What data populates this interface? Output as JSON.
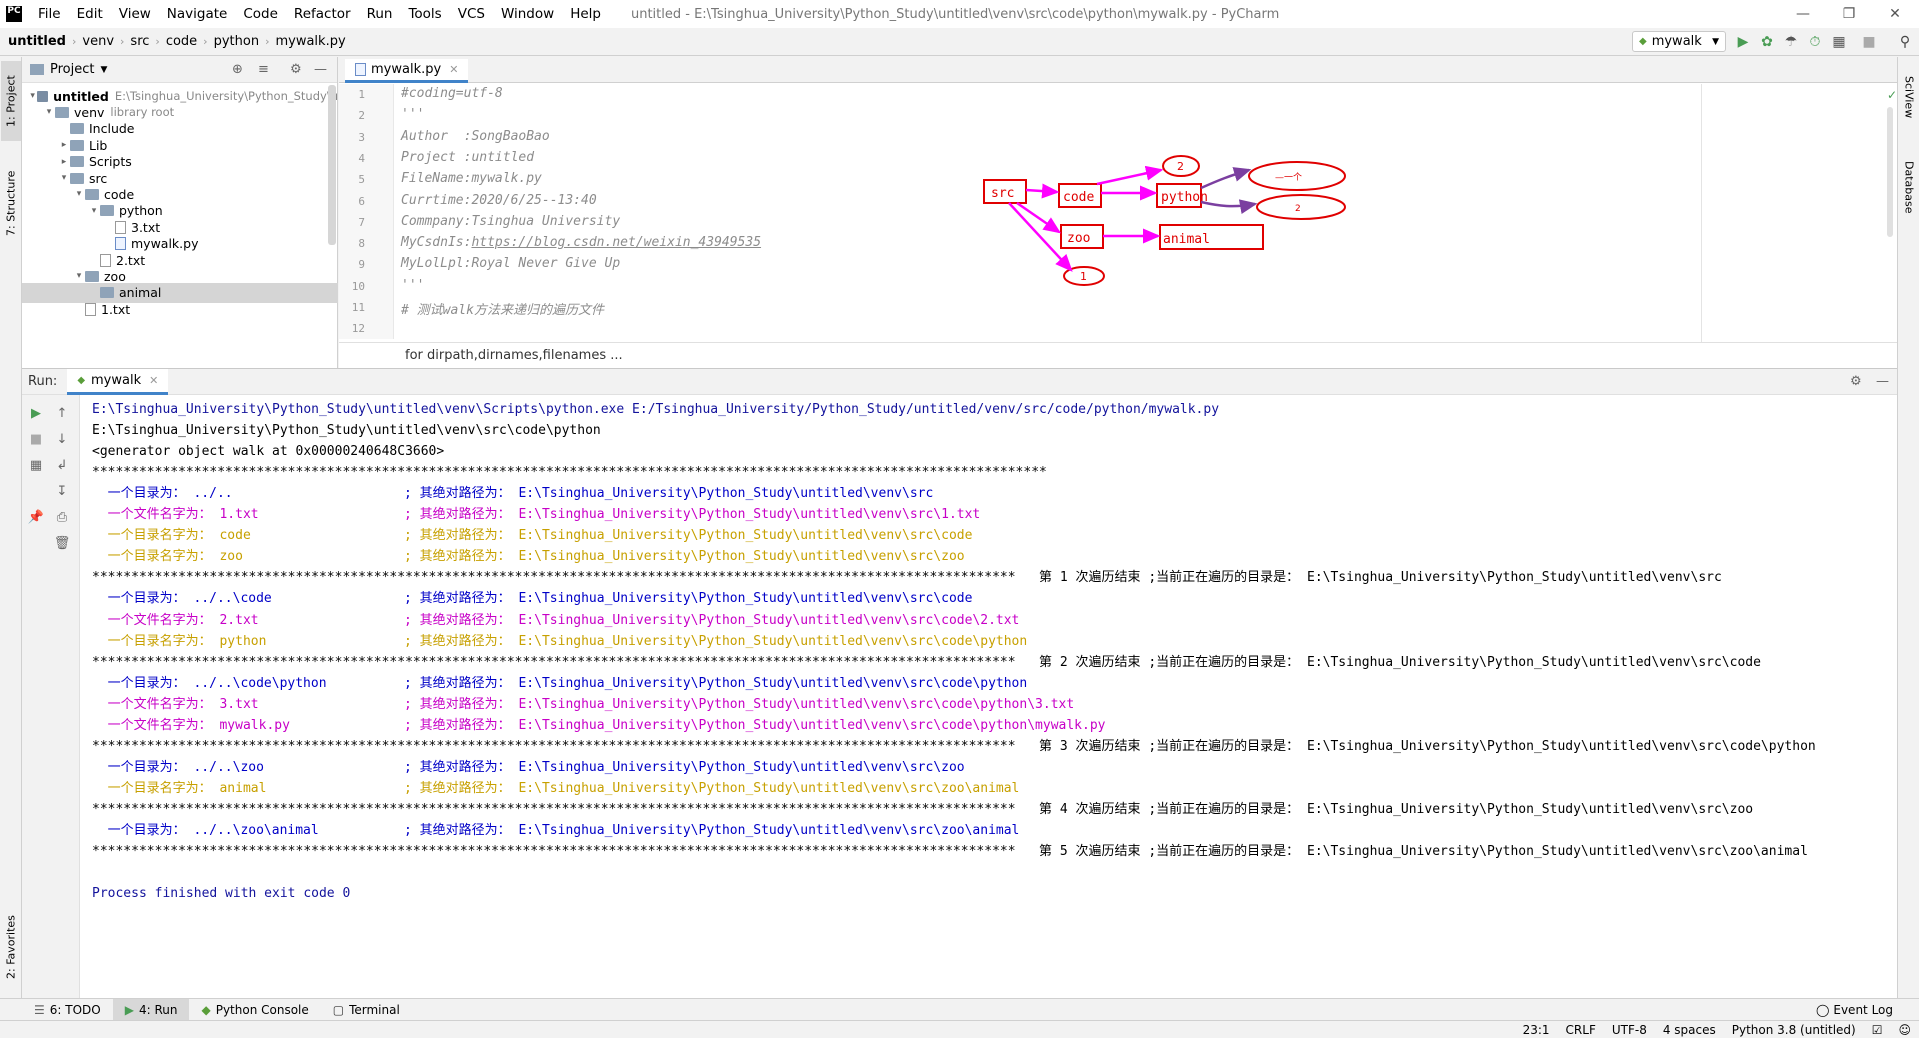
{
  "titlebar": {
    "menu": [
      "File",
      "Edit",
      "View",
      "Navigate",
      "Code",
      "Refactor",
      "Run",
      "Tools",
      "VCS",
      "Window",
      "Help"
    ],
    "title": "untitled - E:\\Tsinghua_University\\Python_Study\\untitled\\venv\\src\\code\\python\\mywalk.py - PyCharm",
    "logo": "PC"
  },
  "navbar": {
    "crumbs": [
      "untitled",
      "venv",
      "src",
      "code",
      "python",
      "mywalk.py"
    ],
    "run_config": "mywalk"
  },
  "left_strip": {
    "project": "1: Project",
    "structure": "7: Structure",
    "favorites": "2: Favorites"
  },
  "right_strip": {
    "sciview": "SciView",
    "database": "Database"
  },
  "project": {
    "header": "Project",
    "tree": [
      {
        "label": "untitled",
        "extra": "E:\\Tsinghua_University\\Python_Study\\u"
      },
      {
        "label": "venv",
        "extra": "library root"
      },
      {
        "label": "Include",
        "extra": ""
      },
      {
        "label": "Lib",
        "extra": ""
      },
      {
        "label": "Scripts",
        "extra": ""
      },
      {
        "label": "src",
        "extra": ""
      },
      {
        "label": "code",
        "extra": ""
      },
      {
        "label": "python",
        "extra": ""
      },
      {
        "label": "3.txt",
        "extra": ""
      },
      {
        "label": "mywalk.py",
        "extra": ""
      },
      {
        "label": "2.txt",
        "extra": ""
      },
      {
        "label": "zoo",
        "extra": ""
      },
      {
        "label": "animal",
        "extra": ""
      },
      {
        "label": "1.txt",
        "extra": ""
      }
    ]
  },
  "editor": {
    "tab": "mywalk.py",
    "lines": [
      {
        "n": "1",
        "t": "#coding=utf-8"
      },
      {
        "n": "2",
        "t": "'''"
      },
      {
        "n": "3",
        "t": "Author  :SongBaoBao"
      },
      {
        "n": "4",
        "t": "Project :untitled"
      },
      {
        "n": "5",
        "t": "FileName:mywalk.py"
      },
      {
        "n": "6",
        "t": "Currtime:2020/6/25--13:40"
      },
      {
        "n": "7",
        "t": "Commpany:Tsinghua University"
      },
      {
        "n": "8",
        "t": "MyCsdnIs:"
      },
      {
        "n": "9",
        "t": "MyLolLpl:Royal Never Give Up"
      },
      {
        "n": "10",
        "t": "'''"
      },
      {
        "n": "11",
        "t": "# 测试walk方法来递归的遍历文件"
      },
      {
        "n": "12",
        "t": ""
      }
    ],
    "csdn_link": "https://blog.csdn.net/weixin_43949535",
    "breadcrumb": "for dirpath,dirnames,filenames ...",
    "diagram": {
      "src": "src",
      "code": "code",
      "python": "python",
      "zoo": "zoo",
      "animal": "animal",
      "n1": "1",
      "n2": "2",
      "scribble1": "—一个",
      "scribble2": "2"
    }
  },
  "run": {
    "label": "Run:",
    "tab": "mywalk",
    "lines": [
      {
        "k": "plain",
        "t": "E:\\Tsinghua_University\\Python_Study\\untitled\\venv\\Scripts\\python.exe E:/Tsinghua_University/Python_Study/untitled/venv/src/code/python/mywalk.py",
        "c": "dkblue"
      },
      {
        "k": "plain",
        "t": "E:\\Tsinghua_University\\Python_Study\\untitled\\venv\\src\\code\\python",
        "c": "blk"
      },
      {
        "k": "plain",
        "t": "<generator object walk at 0x00000240648C3660>",
        "c": "blk"
      },
      {
        "k": "plain",
        "t": "**************************************************************************************************************************",
        "c": "blk"
      },
      {
        "k": "row",
        "c": "blue",
        "a": "  一个目录为： ../..",
        "b": "; 其绝对路径为： E:\\Tsinghua_University\\Python_Study\\untitled\\venv\\src"
      },
      {
        "k": "row",
        "c": "mag",
        "a": "  一个文件名字为： 1.txt",
        "b": "; 其绝对路径为： E:\\Tsinghua_University\\Python_Study\\untitled\\venv\\src\\1.txt"
      },
      {
        "k": "row",
        "c": "gold",
        "a": "  一个目录名字为： code",
        "b": "; 其绝对路径为： E:\\Tsinghua_University\\Python_Study\\untitled\\venv\\src\\code"
      },
      {
        "k": "row",
        "c": "gold",
        "a": "  一个目录名字为： zoo",
        "b": "; 其绝对路径为： E:\\Tsinghua_University\\Python_Study\\untitled\\venv\\src\\zoo"
      },
      {
        "k": "sep",
        "t": "**********************************************************************************************************************   第 1 次遍历结束 ;当前正在遍历的目录是： E:\\Tsinghua_University\\Python_Study\\untitled\\venv\\src"
      },
      {
        "k": "row",
        "c": "blue",
        "a": "  一个目录为： ../..\\code",
        "b": "; 其绝对路径为： E:\\Tsinghua_University\\Python_Study\\untitled\\venv\\src\\code"
      },
      {
        "k": "row",
        "c": "mag",
        "a": "  一个文件名字为： 2.txt",
        "b": "; 其绝对路径为： E:\\Tsinghua_University\\Python_Study\\untitled\\venv\\src\\code\\2.txt"
      },
      {
        "k": "row",
        "c": "gold",
        "a": "  一个目录名字为： python",
        "b": "; 其绝对路径为： E:\\Tsinghua_University\\Python_Study\\untitled\\venv\\src\\code\\python"
      },
      {
        "k": "sep",
        "t": "**********************************************************************************************************************   第 2 次遍历结束 ;当前正在遍历的目录是： E:\\Tsinghua_University\\Python_Study\\untitled\\venv\\src\\code"
      },
      {
        "k": "row",
        "c": "blue",
        "a": "  一个目录为： ../..\\code\\python",
        "b": "; 其绝对路径为： E:\\Tsinghua_University\\Python_Study\\untitled\\venv\\src\\code\\python"
      },
      {
        "k": "row",
        "c": "mag",
        "a": "  一个文件名字为： 3.txt",
        "b": "; 其绝对路径为： E:\\Tsinghua_University\\Python_Study\\untitled\\venv\\src\\code\\python\\3.txt"
      },
      {
        "k": "row",
        "c": "mag",
        "a": "  一个文件名字为： mywalk.py",
        "b": "; 其绝对路径为： E:\\Tsinghua_University\\Python_Study\\untitled\\venv\\src\\code\\python\\mywalk.py"
      },
      {
        "k": "sep",
        "t": "**********************************************************************************************************************   第 3 次遍历结束 ;当前正在遍历的目录是： E:\\Tsinghua_University\\Python_Study\\untitled\\venv\\src\\code\\python"
      },
      {
        "k": "row",
        "c": "blue",
        "a": "  一个目录为： ../..\\zoo",
        "b": "; 其绝对路径为： E:\\Tsinghua_University\\Python_Study\\untitled\\venv\\src\\zoo"
      },
      {
        "k": "row",
        "c": "gold",
        "a": "  一个目录名字为： animal",
        "b": "; 其绝对路径为： E:\\Tsinghua_University\\Python_Study\\untitled\\venv\\src\\zoo\\animal"
      },
      {
        "k": "sep",
        "t": "**********************************************************************************************************************   第 4 次遍历结束 ;当前正在遍历的目录是： E:\\Tsinghua_University\\Python_Study\\untitled\\venv\\src\\zoo"
      },
      {
        "k": "row",
        "c": "blue",
        "a": "  一个目录为： ../..\\zoo\\animal",
        "b": "; 其绝对路径为： E:\\Tsinghua_University\\Python_Study\\untitled\\venv\\src\\zoo\\animal"
      },
      {
        "k": "sep",
        "t": "**********************************************************************************************************************   第 5 次遍历结束 ;当前正在遍历的目录是： E:\\Tsinghua_University\\Python_Study\\untitled\\venv\\src\\zoo\\animal"
      },
      {
        "k": "plain",
        "t": "",
        "c": "blk"
      },
      {
        "k": "plain",
        "t": "Process finished with exit code 0",
        "c": "dkblue"
      }
    ]
  },
  "bottom_tabs": [
    "6: TODO",
    "4: Run",
    "Python Console",
    "Terminal"
  ],
  "event_log": "Event Log",
  "status": {
    "pos": "23:1",
    "eol": "CRLF",
    "enc": "UTF-8",
    "indent": "4 spaces",
    "interp": "Python 3.8 (untitled)"
  },
  "colors": {
    "accent": "#4083c9",
    "diagram_red": "#e00000",
    "diagram_magenta": "#ff00ff",
    "diagram_purple": "#7b3fa0"
  }
}
